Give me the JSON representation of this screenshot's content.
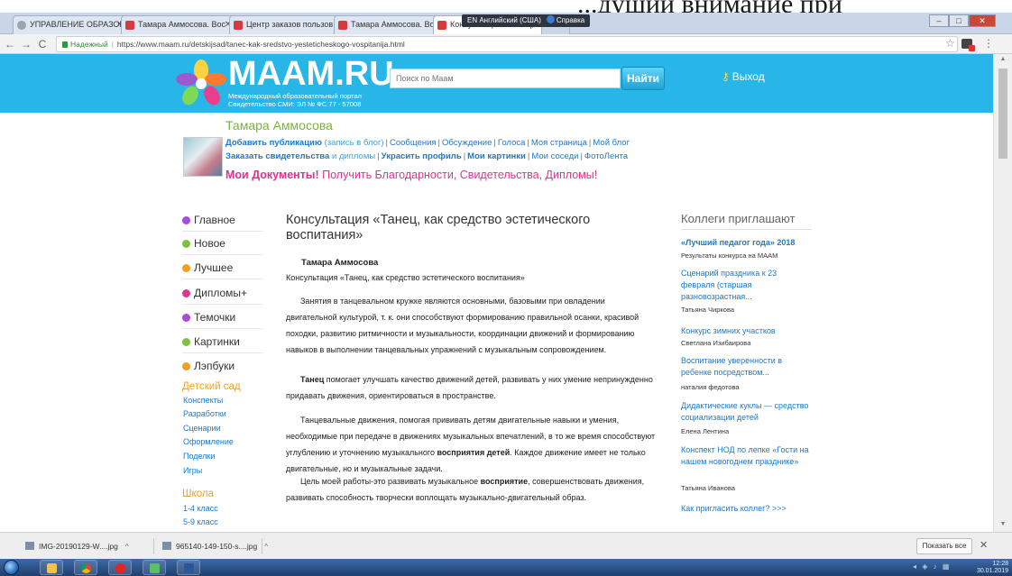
{
  "caption": "...дущий внимание при",
  "browser": {
    "tabs": [
      {
        "label": "УПРАВЛЕНИЕ ОБРАЗОВ",
        "active": false,
        "favicon": "gray"
      },
      {
        "label": "Тамара Аммосова. Вос",
        "active": false,
        "favicon": "maam"
      },
      {
        "label": "Центр заказов пользов",
        "active": false,
        "favicon": "maam"
      },
      {
        "label": "Тамара Аммосова. Вос",
        "active": false,
        "favicon": "maam"
      },
      {
        "label": "Консультация «Танец, к",
        "active": true,
        "favicon": "maam"
      }
    ],
    "language_indicator": "EN Английский (США)",
    "help_label": "Справка",
    "secure_label": "Надежный",
    "url": "https://www.maam.ru/detskijsad/tanec-kak-sredstvo-yesteticheskogo-vospitanija.html"
  },
  "site": {
    "logo": "MAAM.RU",
    "logo_sub_1": "Международный образовательный портал",
    "logo_sub_2": "Свидетельство СМИ: ЭЛ № ФС 77 - 57008",
    "search_placeholder": "Поиск по Маам",
    "search_button": "Найти",
    "logout": "Выход",
    "brand_color": "#28b6e8"
  },
  "user": {
    "name": "Тамара Аммосова",
    "links_row1": {
      "add_publication": "Добавить публикацию",
      "blog_note": "(запись в блог)",
      "items": [
        "Сообщения",
        "Обсуждение",
        "Голоса",
        "Моя страница",
        "Мой блог"
      ]
    },
    "links_row2": {
      "order_cert": "Заказать свидетельства",
      "diplomas": "и дипломы",
      "decorate": "Украсить профиль",
      "my_pictures": "Мои картинки",
      "neighbors": "Мои соседи",
      "photo_feed": "ФотоЛента"
    },
    "mydocs_bold": "Мои Документы!",
    "mydocs_text": "Получить Благодарности, Свидетельства, Дипломы!"
  },
  "left_nav": {
    "items": [
      {
        "label": "Главное",
        "color": "#a84dd6"
      },
      {
        "label": "Новое",
        "color": "#7ec040"
      },
      {
        "label": "Лучшее",
        "color": "#f0a020"
      },
      {
        "label": "Дипломы+",
        "color": "#e0388c"
      },
      {
        "label": "Темочки",
        "color": "#a84dd6"
      },
      {
        "label": "Картинки",
        "color": "#7ec040"
      },
      {
        "label": "Лэпбуки",
        "color": "#f0a020"
      }
    ],
    "kindergarten": {
      "title": "Детский сад",
      "links": [
        "Конспекты",
        "Разработки",
        "Сценарии",
        "Оформление",
        "Поделки",
        "Игры"
      ]
    },
    "school": {
      "title": "Школа",
      "links": [
        "1-4 класс",
        "5-9 класс"
      ]
    }
  },
  "article": {
    "title": "Консультация «Танец, как средство эстетического воспитания»",
    "author": "Тамара Аммосова",
    "subtitle": "Консультация «Танец, как средство эстетического воспитания»",
    "p1": "Занятия в танцевальном кружке являются основными, базовыми при овладении двигательной культурой, т. к. они способствуют формированию правильной осанки, красивой походки, развитию ритмичности и музыкальности, координации движений и формированию навыков в выполнении танцевальных упражнений с музыкальным сопровождением.",
    "p2_bold": "Танец",
    "p2_rest": " помогает улучшать качество движений детей, развивать у них умение непринужденно придавать движения, ориентироваться в пространстве.",
    "p3_a": "Танцевальные движения, помогая прививать детям двигательные навыки и умения, необходимые при передаче в движениях музыкальных впечатлений, в то же время способствуют углублению и уточнению музыкального ",
    "p3_bold": "восприятия детей",
    "p3_b": ". Каждое движение имеет не только двигательные, но и музыкальные задачи.",
    "p4_a": "Цель моей работы-это развивать музыкальное ",
    "p4_bold": "восприятие",
    "p4_b": ", совершенствовать движения, развивать способность творчески воплощать музыкально-двигательный образ."
  },
  "right_col": {
    "heading": "Коллеги приглашают",
    "items": [
      {
        "title": "«Лучший педагог года» 2018",
        "meta": "Результаты конкурса на МААМ",
        "bold": true
      },
      {
        "title": "Сценарий праздника к 23 февраля (старшая разновозрастная...",
        "meta": "Татьяна Чиркова",
        "bold": false
      },
      {
        "title": "Конкурс зимних участков",
        "meta": "Светлана Изибаирова",
        "bold": false
      },
      {
        "title": "Воспитание уверенности в ребенке посредством...",
        "meta": "наталия федотова",
        "bold": false
      },
      {
        "title": "Дидактические куклы — средство социализации детей",
        "meta": "Елена Лентина",
        "bold": false
      },
      {
        "title": "Конспект НОД по лепке «Гости на нашем новогоднем празднике»",
        "meta": "Татьяна Иванова",
        "bold": false
      },
      {
        "title": "Как пригласить коллег? >>>",
        "meta": "",
        "bold": false
      }
    ]
  },
  "downloads": {
    "items": [
      "IMG-20190129-W....jpg",
      "965140-149-150-s....jpg"
    ],
    "show_all": "Показать все"
  },
  "taskbar": {
    "time": "12:28",
    "date": "30.01.2019"
  }
}
